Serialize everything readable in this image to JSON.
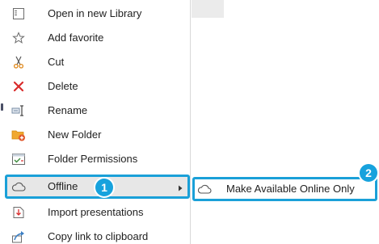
{
  "colors": {
    "accent": "#1aa0d8",
    "badge": "#17a2dd",
    "delete_red": "#d92b2b",
    "folder_orange": "#f0a830",
    "hover_bg": "#e7e7e7"
  },
  "menu": {
    "items": [
      {
        "label": "Open in new Library",
        "icon": "library-icon"
      },
      {
        "label": "Add favorite",
        "icon": "star-icon"
      },
      {
        "label": "Cut",
        "icon": "scissors-icon"
      },
      {
        "label": "Delete",
        "icon": "delete-x-icon"
      },
      {
        "label": "Rename",
        "icon": "rename-icon"
      },
      {
        "label": "New Folder",
        "icon": "new-folder-icon"
      },
      {
        "label": "Folder Permissions",
        "icon": "folder-permissions-icon"
      },
      {
        "label": "Offline",
        "icon": "cloud-icon",
        "has_submenu": true,
        "active": true
      },
      {
        "label": "Import presentations",
        "icon": "import-icon"
      },
      {
        "label": "Copy link to clipboard",
        "icon": "share-link-icon"
      }
    ]
  },
  "submenu": {
    "items": [
      {
        "label": "Make Available Online Only",
        "icon": "cloud-icon"
      }
    ]
  },
  "callouts": {
    "step1": "1",
    "step2": "2"
  }
}
